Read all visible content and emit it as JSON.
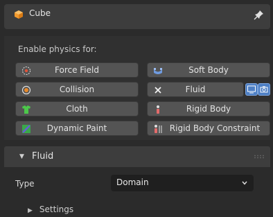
{
  "header": {
    "object_name": "Cube"
  },
  "physics": {
    "enable_label": "Enable physics for:",
    "buttons": [
      {
        "label": "Force Field",
        "icon": "force-field-icon"
      },
      {
        "label": "Soft Body",
        "icon": "soft-body-icon"
      },
      {
        "label": "Collision",
        "icon": "collision-icon"
      },
      {
        "label": "Fluid",
        "icon": "close-icon"
      },
      {
        "label": "Cloth",
        "icon": "cloth-icon"
      },
      {
        "label": "Rigid Body",
        "icon": "rigid-body-icon"
      },
      {
        "label": "Dynamic Paint",
        "icon": "dynamic-paint-icon"
      },
      {
        "label": "Rigid Body Constraint",
        "icon": "rigid-body-constraint-icon"
      }
    ]
  },
  "fluid_panel": {
    "title": "Fluid",
    "type_label": "Type",
    "type_value": "Domain",
    "settings_label": "Settings"
  },
  "colors": {
    "panel_bg": "#2b2b2b",
    "button_bg": "#545454",
    "accent_blue": "#4d7fc4"
  }
}
